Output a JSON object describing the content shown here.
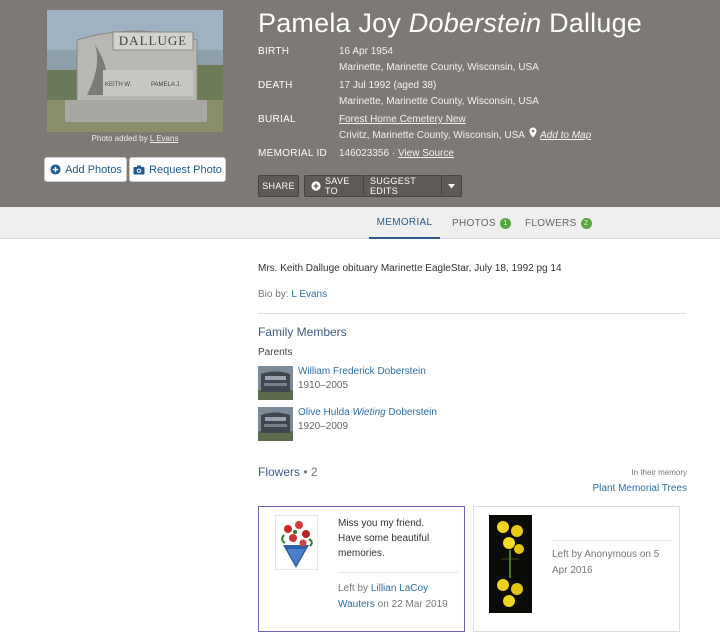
{
  "header": {
    "photo_caption_prefix": "Photo added by",
    "photo_caption_author": "L Evans",
    "headstone_text": "DALLUGE",
    "headstone_names": [
      "KEITH W.",
      "PAMELA J."
    ],
    "add_photos_label": "Add Photos",
    "request_photo_label": "Request Photo",
    "name_first": "Pamela Joy",
    "name_maiden": "Doberstein",
    "name_last": "Dalluge",
    "birth_label": "BIRTH",
    "birth_date": "16 Apr 1954",
    "birth_place": "Marinette, Marinette County, Wisconsin, USA",
    "death_label": "DEATH",
    "death_date": "17 Jul 1992 (aged 38)",
    "death_place": "Marinette, Marinette County, Wisconsin, USA",
    "burial_label": "BURIAL",
    "burial_cemetery": "Forest Home Cemetery New",
    "burial_place": "Crivitz, Marinette County, Wisconsin, USA",
    "add_to_map_label": "Add to Map",
    "memorial_id_label": "MEMORIAL ID",
    "memorial_id": "146023356",
    "memorial_id_sep": " · ",
    "view_source_label": "View Source",
    "share_label": "SHARE",
    "save_to_label": "SAVE TO",
    "suggest_edits_label": "SUGGEST EDITS"
  },
  "tabs": [
    {
      "label": "MEMORIAL",
      "badge": ""
    },
    {
      "label": "PHOTOS",
      "badge": "1"
    },
    {
      "label": "FLOWERS",
      "badge": "2"
    }
  ],
  "memorial": {
    "obituary": "Mrs. Keith Dalluge obituary Marinette EagleStar, July 18, 1992 pg 14",
    "bio_prefix": "Bio by:",
    "bio_author": "L Evans"
  },
  "family": {
    "title": "Family Members",
    "parents_label": "Parents",
    "parents": [
      {
        "name_first": "William Frederick Doberstein",
        "name_italic": "",
        "name_last": "",
        "dates": "1910–2005"
      },
      {
        "name_first": "Olive Hulda",
        "name_italic": "Wieting",
        "name_last": "Doberstein",
        "dates": "1920–2009"
      }
    ]
  },
  "flowers": {
    "title": "Flowers",
    "count_text": "• 2",
    "in_their_memory": "In their memory",
    "plant_trees_label": "Plant Memorial Trees",
    "cards": [
      {
        "message_lines": [
          "Miss you my friend.",
          "Have some beautiful",
          "memories."
        ],
        "left_by_prefix": "Left by",
        "author": "Lillian LaCoy Wauters",
        "date_text": "on 22 Mar 2019"
      },
      {
        "left_by_text": "Left by Anonymous on 5 Apr 2016"
      }
    ]
  },
  "icons": {
    "add_photos": "plus-circle-icon",
    "request_photo": "camera-icon",
    "add_to_map": "map-pin-icon",
    "save_to": "plus-circle-icon",
    "more": "caret-down-icon"
  },
  "colors": {
    "header_bg": "#7d7a76",
    "link": "#2d6ea8",
    "section_title": "#3e5a86",
    "badge": "#55a63b",
    "selected_card_border": "#6a65b8"
  }
}
